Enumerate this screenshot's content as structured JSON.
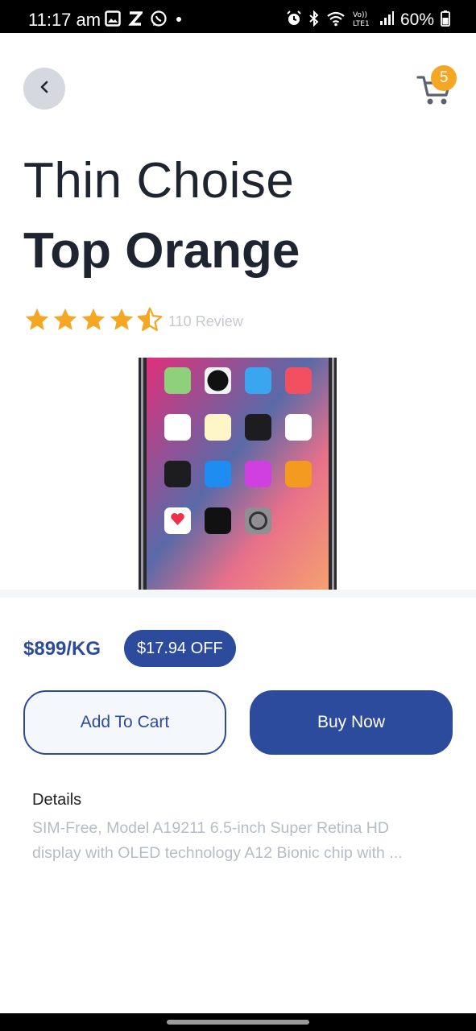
{
  "status_bar": {
    "time": "11:17 am",
    "battery": "60%",
    "left_icons": [
      "gallery-icon",
      "z-icon",
      "whatsapp-icon",
      "dot-icon"
    ],
    "right_icons": [
      "alarm-icon",
      "bluetooth-icon",
      "wifi-icon",
      "volte-icon",
      "signal-icon",
      "battery-icon"
    ]
  },
  "header": {
    "back_icon": "chevron-left-icon",
    "cart_icon": "cart-icon",
    "cart_count": "5"
  },
  "product": {
    "title_light": "Thin Choise",
    "title_bold": "Top Orange",
    "rating": 4.5,
    "rating_max": 5,
    "review_text": "110 Review",
    "image_icon": "phone-product-image",
    "price": "$899/KG",
    "discount": "$17.94 OFF"
  },
  "actions": {
    "add_to_cart": "Add To Cart",
    "buy_now": "Buy Now"
  },
  "details": {
    "title": "Details",
    "text": "SIM-Free, Model A19211 6.5-inch Super Retina HD display with OLED technology A12 Bionic chip with ..."
  },
  "colors": {
    "primary": "#2c4b9c",
    "star": "#f5a623",
    "badge": "#f5a623",
    "text_dark": "#1f2530",
    "muted": "#b6bcc4"
  }
}
